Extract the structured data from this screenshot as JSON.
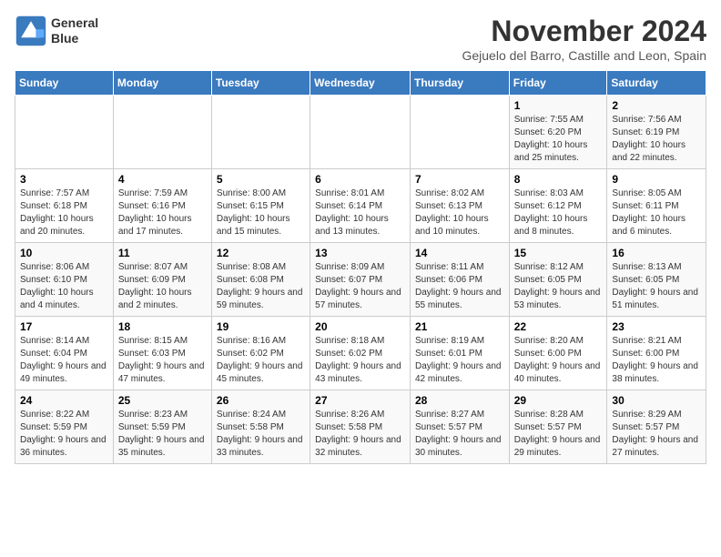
{
  "logo": {
    "line1": "General",
    "line2": "Blue"
  },
  "title": "November 2024",
  "subtitle": "Gejuelo del Barro, Castille and Leon, Spain",
  "days_of_week": [
    "Sunday",
    "Monday",
    "Tuesday",
    "Wednesday",
    "Thursday",
    "Friday",
    "Saturday"
  ],
  "weeks": [
    [
      {
        "day": "",
        "info": ""
      },
      {
        "day": "",
        "info": ""
      },
      {
        "day": "",
        "info": ""
      },
      {
        "day": "",
        "info": ""
      },
      {
        "day": "",
        "info": ""
      },
      {
        "day": "1",
        "info": "Sunrise: 7:55 AM\nSunset: 6:20 PM\nDaylight: 10 hours and 25 minutes."
      },
      {
        "day": "2",
        "info": "Sunrise: 7:56 AM\nSunset: 6:19 PM\nDaylight: 10 hours and 22 minutes."
      }
    ],
    [
      {
        "day": "3",
        "info": "Sunrise: 7:57 AM\nSunset: 6:18 PM\nDaylight: 10 hours and 20 minutes."
      },
      {
        "day": "4",
        "info": "Sunrise: 7:59 AM\nSunset: 6:16 PM\nDaylight: 10 hours and 17 minutes."
      },
      {
        "day": "5",
        "info": "Sunrise: 8:00 AM\nSunset: 6:15 PM\nDaylight: 10 hours and 15 minutes."
      },
      {
        "day": "6",
        "info": "Sunrise: 8:01 AM\nSunset: 6:14 PM\nDaylight: 10 hours and 13 minutes."
      },
      {
        "day": "7",
        "info": "Sunrise: 8:02 AM\nSunset: 6:13 PM\nDaylight: 10 hours and 10 minutes."
      },
      {
        "day": "8",
        "info": "Sunrise: 8:03 AM\nSunset: 6:12 PM\nDaylight: 10 hours and 8 minutes."
      },
      {
        "day": "9",
        "info": "Sunrise: 8:05 AM\nSunset: 6:11 PM\nDaylight: 10 hours and 6 minutes."
      }
    ],
    [
      {
        "day": "10",
        "info": "Sunrise: 8:06 AM\nSunset: 6:10 PM\nDaylight: 10 hours and 4 minutes."
      },
      {
        "day": "11",
        "info": "Sunrise: 8:07 AM\nSunset: 6:09 PM\nDaylight: 10 hours and 2 minutes."
      },
      {
        "day": "12",
        "info": "Sunrise: 8:08 AM\nSunset: 6:08 PM\nDaylight: 9 hours and 59 minutes."
      },
      {
        "day": "13",
        "info": "Sunrise: 8:09 AM\nSunset: 6:07 PM\nDaylight: 9 hours and 57 minutes."
      },
      {
        "day": "14",
        "info": "Sunrise: 8:11 AM\nSunset: 6:06 PM\nDaylight: 9 hours and 55 minutes."
      },
      {
        "day": "15",
        "info": "Sunrise: 8:12 AM\nSunset: 6:05 PM\nDaylight: 9 hours and 53 minutes."
      },
      {
        "day": "16",
        "info": "Sunrise: 8:13 AM\nSunset: 6:05 PM\nDaylight: 9 hours and 51 minutes."
      }
    ],
    [
      {
        "day": "17",
        "info": "Sunrise: 8:14 AM\nSunset: 6:04 PM\nDaylight: 9 hours and 49 minutes."
      },
      {
        "day": "18",
        "info": "Sunrise: 8:15 AM\nSunset: 6:03 PM\nDaylight: 9 hours and 47 minutes."
      },
      {
        "day": "19",
        "info": "Sunrise: 8:16 AM\nSunset: 6:02 PM\nDaylight: 9 hours and 45 minutes."
      },
      {
        "day": "20",
        "info": "Sunrise: 8:18 AM\nSunset: 6:02 PM\nDaylight: 9 hours and 43 minutes."
      },
      {
        "day": "21",
        "info": "Sunrise: 8:19 AM\nSunset: 6:01 PM\nDaylight: 9 hours and 42 minutes."
      },
      {
        "day": "22",
        "info": "Sunrise: 8:20 AM\nSunset: 6:00 PM\nDaylight: 9 hours and 40 minutes."
      },
      {
        "day": "23",
        "info": "Sunrise: 8:21 AM\nSunset: 6:00 PM\nDaylight: 9 hours and 38 minutes."
      }
    ],
    [
      {
        "day": "24",
        "info": "Sunrise: 8:22 AM\nSunset: 5:59 PM\nDaylight: 9 hours and 36 minutes."
      },
      {
        "day": "25",
        "info": "Sunrise: 8:23 AM\nSunset: 5:59 PM\nDaylight: 9 hours and 35 minutes."
      },
      {
        "day": "26",
        "info": "Sunrise: 8:24 AM\nSunset: 5:58 PM\nDaylight: 9 hours and 33 minutes."
      },
      {
        "day": "27",
        "info": "Sunrise: 8:26 AM\nSunset: 5:58 PM\nDaylight: 9 hours and 32 minutes."
      },
      {
        "day": "28",
        "info": "Sunrise: 8:27 AM\nSunset: 5:57 PM\nDaylight: 9 hours and 30 minutes."
      },
      {
        "day": "29",
        "info": "Sunrise: 8:28 AM\nSunset: 5:57 PM\nDaylight: 9 hours and 29 minutes."
      },
      {
        "day": "30",
        "info": "Sunrise: 8:29 AM\nSunset: 5:57 PM\nDaylight: 9 hours and 27 minutes."
      }
    ]
  ]
}
